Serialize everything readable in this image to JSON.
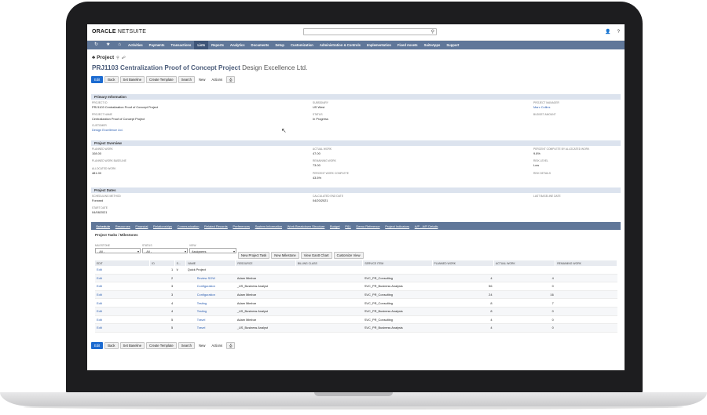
{
  "app": {
    "logo_bold": "ORACLE",
    "logo_thin": " NETSUITE"
  },
  "topbar": {
    "search_placeholder": "",
    "icons": [
      "user-menu-icon",
      "help-icon"
    ],
    "user_glyph": "👤",
    "help_glyph": "?"
  },
  "nav": {
    "icons": [
      "recent-icon",
      "star-icon",
      "home-icon"
    ],
    "icon_glyphs": [
      "↻",
      "★",
      "⌂"
    ],
    "items": [
      "Activities",
      "Payments",
      "Transactions",
      "Lists",
      "Reports",
      "Analytics",
      "Documents",
      "Setup",
      "Customization",
      "Administration & Controls",
      "Implementation",
      "Fixed Assets",
      "SuiteApps",
      "Support"
    ],
    "active": "Lists"
  },
  "record": {
    "type": "Project",
    "id_title": "PRJ1103 Centralization Proof of Concept Project",
    "customer_title": "Design Excellence Ltd."
  },
  "buttons": [
    "Edit",
    "Back",
    "Set Baseline",
    "Create Template",
    "Search",
    "New",
    "Actions"
  ],
  "sections": {
    "primary": "Primary Information",
    "overview": "Project Overview",
    "dates": "Project Dates"
  },
  "primary": {
    "project_id": {
      "label": "Project ID",
      "value": "PRJ1103 Centralization Proof of Concept Project"
    },
    "project_name": {
      "label": "Project Name",
      "value": "Centralization Proof of Concept Project"
    },
    "customer": {
      "label": "Customer",
      "value": "Design Excellence Ltd."
    },
    "subsidiary": {
      "label": "Subsidiary",
      "value": "US West"
    },
    "status": {
      "label": "Status",
      "value": "In Progress"
    },
    "manager": {
      "label": "Project Manager",
      "value": "Marc Collins"
    },
    "budget": {
      "label": "Budget Amount",
      "value": ""
    }
  },
  "overview": {
    "planned_work": {
      "label": "Planned Work",
      "value": "108.00"
    },
    "planned_baseline": {
      "label": "Planned Work Baseline",
      "value": ""
    },
    "allocated_work": {
      "label": "Allocated Work",
      "value": "481.00"
    },
    "actual_work": {
      "label": "Actual Work",
      "value": "47.00"
    },
    "remaining_work": {
      "label": "Remaining Work",
      "value": "73.00"
    },
    "percent_complete": {
      "label": "Percent Work Complete",
      "value": "43.5%"
    },
    "pct_by_allocated": {
      "label": "Percent Complete by Allocated Work",
      "value": "9.8%"
    },
    "risk_level": {
      "label": "Risk Level",
      "value": "Low"
    },
    "risk_details": {
      "label": "Risk Details",
      "value": ""
    }
  },
  "dates": {
    "scheduling": {
      "label": "Scheduling Method",
      "value": "Forward"
    },
    "start": {
      "label": "Start Date",
      "value": "04/08/2021"
    },
    "calc_end": {
      "label": "Calculated End Date",
      "value": "04/20/2021"
    },
    "baseline_end": {
      "label": "Last Baseline Date",
      "value": ""
    }
  },
  "subtabs": [
    "Schedule",
    "Resources",
    "Financial",
    "Relationships",
    "Communication",
    "Related Records",
    "Preferences",
    "System Information",
    "Work Breakdown Structure",
    "Budget",
    "P&L",
    "Demo Reference",
    "Project Indicators",
    "A/P - A/R Details"
  ],
  "tasks": {
    "title": "Project Tasks / Milestones",
    "filters": {
      "milestone": {
        "label": "Milestone",
        "value": "- All -"
      },
      "status": {
        "label": "Status",
        "value": "- All -"
      },
      "view": {
        "label": "View",
        "value": "Assignees"
      }
    },
    "actions": [
      "New Project Task",
      "New Milestone",
      "View Gantt Chart",
      "Customize View"
    ],
    "columns": [
      "Edit",
      "ID",
      "S...",
      "Name",
      "Resource",
      "Billing Class",
      "Service Item",
      "Planned Work",
      "Actual Work",
      "Remaining Work"
    ],
    "rows": [
      {
        "edit": "Edit",
        "id": "1",
        "exp": "∨",
        "name": "Quick Project",
        "indent": 0,
        "resource": "",
        "billing": "",
        "service": "",
        "planned": "",
        "actual": "",
        "remaining": ""
      },
      {
        "edit": "Edit",
        "id": "2",
        "exp": "",
        "name": "Review SOW",
        "indent": 1,
        "resource": "Adam Mimbar",
        "billing": "",
        "service": "SVC_PR_Consulting",
        "planned": "4",
        "actual": "4",
        "remaining": ""
      },
      {
        "edit": "Edit",
        "id": "3",
        "exp": "",
        "name": "Configuration",
        "indent": 1,
        "resource": "_US_Business Analyst",
        "billing": "",
        "service": "SVC_PR_Business Analysis",
        "planned": "56",
        "actual": "0",
        "remaining": ""
      },
      {
        "edit": "Edit",
        "id": "3",
        "exp": "",
        "name": "Configuration",
        "indent": 1,
        "resource": "Adam Mimbar",
        "billing": "",
        "service": "SVC_PR_Consulting",
        "planned": "24",
        "actual": "16",
        "remaining": ""
      },
      {
        "edit": "Edit",
        "id": "4",
        "exp": "",
        "name": "Testing",
        "indent": 1,
        "resource": "Adam Mimbar",
        "billing": "",
        "service": "SVC_PR_Consulting",
        "planned": "8",
        "actual": "7",
        "remaining": ""
      },
      {
        "edit": "Edit",
        "id": "4",
        "exp": "",
        "name": "Testing",
        "indent": 1,
        "resource": "_US_Business Analyst",
        "billing": "",
        "service": "SVC_PR_Business Analysis",
        "planned": "8",
        "actual": "0",
        "remaining": ""
      },
      {
        "edit": "Edit",
        "id": "5",
        "exp": "",
        "name": "Travel",
        "indent": 1,
        "resource": "Adam Mimbar",
        "billing": "",
        "service": "SVC_PR_Consulting",
        "planned": "4",
        "actual": "0",
        "remaining": ""
      },
      {
        "edit": "Edit",
        "id": "5",
        "exp": "",
        "name": "Travel",
        "indent": 1,
        "resource": "_US_Business Analyst",
        "billing": "",
        "service": "SVC_PR_Business Analysis",
        "planned": "4",
        "actual": "0",
        "remaining": ""
      }
    ]
  },
  "colors": {
    "nav": "#607799",
    "nav_active": "#3e5578",
    "primary_button": "#1c6bd0",
    "title": "#4b5c7a",
    "section": "#dce3ee"
  }
}
